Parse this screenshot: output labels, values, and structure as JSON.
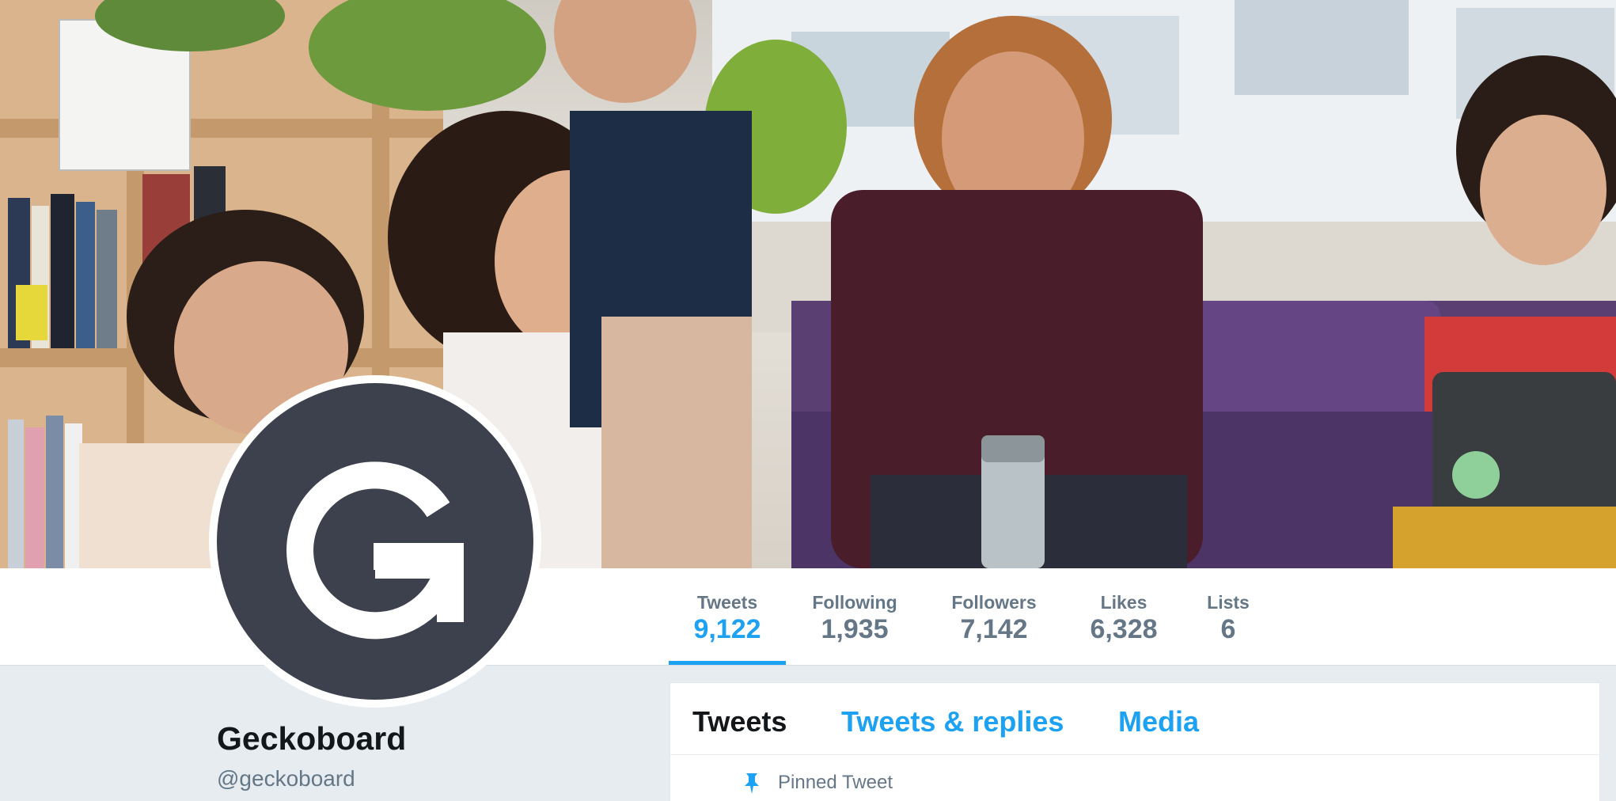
{
  "profile": {
    "name": "Geckoboard",
    "handle": "@geckoboard",
    "avatar_letter": "G",
    "avatar_color": "#3d414d"
  },
  "stats": [
    {
      "label": "Tweets",
      "value": "9,122",
      "active": true
    },
    {
      "label": "Following",
      "value": "1,935",
      "active": false
    },
    {
      "label": "Followers",
      "value": "7,142",
      "active": false
    },
    {
      "label": "Likes",
      "value": "6,328",
      "active": false
    },
    {
      "label": "Lists",
      "value": "6",
      "active": false
    }
  ],
  "timeline": {
    "tabs": [
      {
        "label": "Tweets",
        "active": true
      },
      {
        "label": "Tweets & replies",
        "active": false
      },
      {
        "label": "Media",
        "active": false
      }
    ],
    "pinned_label": "Pinned Tweet"
  },
  "colors": {
    "accent": "#1da1f2",
    "muted_text": "#657786",
    "dark_text": "#14171a",
    "page_bg": "#e6ecf0"
  }
}
